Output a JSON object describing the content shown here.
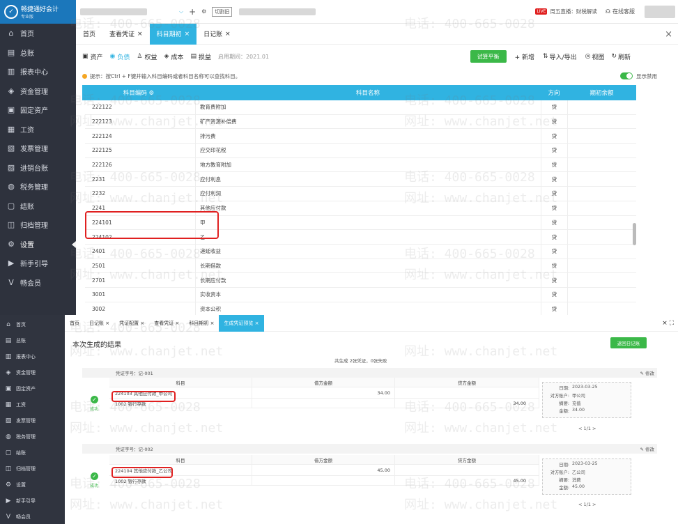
{
  "top_shot": {
    "app_name": "畅捷通好会计",
    "app_sub": "专业版",
    "topbar": {
      "switch_label": "切割旧",
      "live": "周五直播：财税解读",
      "service": "在线客服"
    },
    "sidebar": [
      "首页",
      "总账",
      "报表中心",
      "资金管理",
      "固定资产",
      "工资",
      "发票管理",
      "进销台账",
      "税务管理",
      "结账",
      "归档管理",
      "设置",
      "新手引导",
      "畅会员"
    ],
    "tabs": [
      "首页",
      "查看凭证",
      "科目期初",
      "日记账"
    ],
    "toolbar": {
      "items": [
        "资产",
        "负债",
        "权益",
        "成本",
        "损益"
      ],
      "enable_date": "启用期间：2021.01",
      "trial_balance": "试算平衡",
      "add": "+ 新增",
      "import_export": "导入/导出",
      "view": "视图",
      "refresh": "刷新"
    },
    "tip": "提示：按Ctrl + F键并输入科目编码或者科目名称可以查找科目。",
    "show_disabled": "显示禁用",
    "table_headers": [
      "科目编码",
      "科目名称",
      "方向",
      "期初余额"
    ],
    "rows": [
      {
        "code": "222122",
        "name": "教育费附加",
        "dir": "贷"
      },
      {
        "code": "222123",
        "name": "矿产资源补偿费",
        "dir": "贷"
      },
      {
        "code": "222124",
        "name": "排污费",
        "dir": "贷"
      },
      {
        "code": "222125",
        "name": "应交印花税",
        "dir": "贷"
      },
      {
        "code": "222126",
        "name": "地方教育附加",
        "dir": "贷"
      },
      {
        "code": "2231",
        "name": "应付利息",
        "dir": "贷"
      },
      {
        "code": "2232",
        "name": "应付利润",
        "dir": "贷"
      },
      {
        "code": "2241",
        "name": "其他应付款",
        "dir": "贷"
      },
      {
        "code": "224101",
        "name": "甲",
        "dir": "贷"
      },
      {
        "code": "224102",
        "name": "乙",
        "dir": "贷"
      },
      {
        "code": "2401",
        "name": "递延收益",
        "dir": "贷"
      },
      {
        "code": "2501",
        "name": "长期借款",
        "dir": "贷"
      },
      {
        "code": "2701",
        "name": "长期应付款",
        "dir": "贷"
      },
      {
        "code": "3001",
        "name": "实收资本",
        "dir": "贷"
      },
      {
        "code": "3002",
        "name": "资本公积",
        "dir": "贷"
      }
    ]
  },
  "bottom_shot": {
    "sidebar": [
      "首页",
      "总账",
      "报表中心",
      "资金管理",
      "固定资产",
      "工资",
      "发票管理",
      "税务管理",
      "结账",
      "归档管理",
      "设置",
      "新手引导",
      "畅会员"
    ],
    "tabs": [
      "首页",
      "日记账",
      "凭证配置",
      "查看凭证",
      "科目期初",
      "生成凭证预览"
    ],
    "title": "本次生成的结果",
    "back_button": "返回日记账",
    "summary": "共生成 2张凭证，0张失败",
    "col_headers": [
      "科目",
      "借方金额",
      "贷方金额"
    ],
    "edit": "修改",
    "success": "成功",
    "vouchers": [
      {
        "no": "凭证字号：记-001",
        "line1": "224103 其他应付款_甲公司",
        "debit": "34.00",
        "line2": "1002 银行存款",
        "credit": "34.00",
        "info": {
          "date": "2023-03-25",
          "party": "甲公司",
          "summary": "充值",
          "amount": "34.00"
        },
        "pager": "< 1/1 >"
      },
      {
        "no": "凭证字号：记-002",
        "line1": "224104 其他应付款_乙公司",
        "debit": "45.00",
        "line2": "1002 银行存款",
        "credit": "45.00",
        "info": {
          "date": "2023-03-25",
          "party": "乙公司",
          "summary": "消费",
          "amount": "45.00"
        },
        "pager": "< 1/1 >"
      }
    ],
    "info_labels": {
      "date": "日期:",
      "party": "对方账户:",
      "summary": "摘要:",
      "amount": "金额:"
    }
  },
  "watermark": {
    "phone": "电话: 400-665-0028",
    "site": "网址: www.chanjet.net"
  },
  "colors": {
    "accent": "#30b3e1",
    "sidebar": "#2e323d",
    "green": "#3bb848",
    "red": "#e02020"
  }
}
